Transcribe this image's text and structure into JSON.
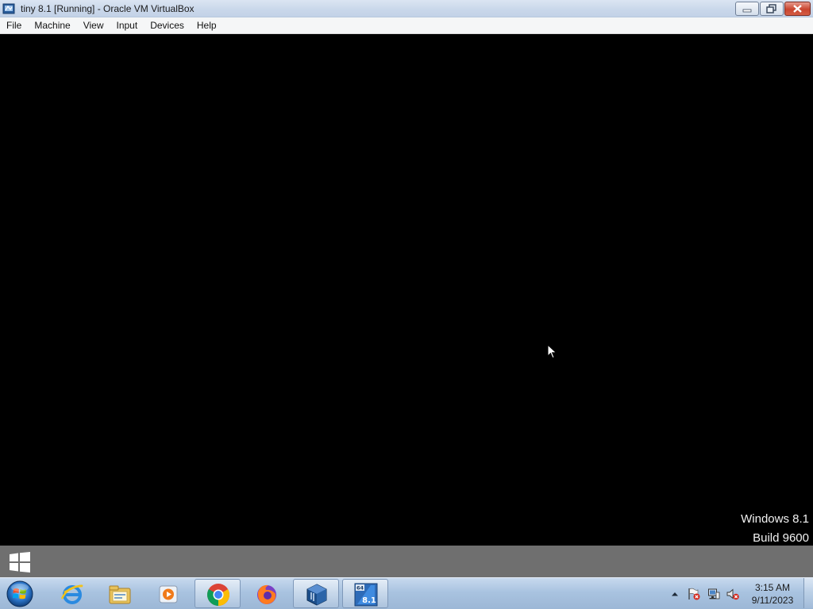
{
  "window": {
    "title": "tiny 8.1 [Running] - Oracle VM VirtualBox",
    "app_icon": "virtualbox-icon",
    "controls": [
      "minimize-icon",
      "restore-icon",
      "close-icon"
    ]
  },
  "menubar": {
    "items": [
      {
        "label": "File"
      },
      {
        "label": "Machine"
      },
      {
        "label": "View"
      },
      {
        "label": "Input"
      },
      {
        "label": "Devices"
      },
      {
        "label": "Help"
      }
    ]
  },
  "guest": {
    "watermark_line1": "Windows 8.1",
    "watermark_line2": "Build 9600",
    "start_icon": "windows-logo-icon"
  },
  "taskbar": {
    "start_icon": "windows-orb-icon",
    "pinned": [
      {
        "icon": "internet-explorer-icon",
        "active": false
      },
      {
        "icon": "file-explorer-icon",
        "active": false
      },
      {
        "icon": "media-player-icon",
        "active": false
      },
      {
        "icon": "chrome-icon",
        "active": true
      },
      {
        "icon": "firefox-icon",
        "active": false
      },
      {
        "icon": "virtualbox-icon",
        "active": true
      },
      {
        "icon": "vm-windows-8-1-icon",
        "active": true,
        "badge": "64",
        "label": "8.1"
      }
    ],
    "tray_icons": [
      "show-hidden-icons-arrow",
      "action-center-flag-icon",
      "network-icon",
      "volume-muted-icon"
    ],
    "clock_time": "3:15 AM",
    "clock_date": "9/11/2023"
  },
  "colors": {
    "guest_background": "#000000",
    "guest_taskbar": "#6f6f6f",
    "host_taskbar": "#a9c3e0"
  }
}
